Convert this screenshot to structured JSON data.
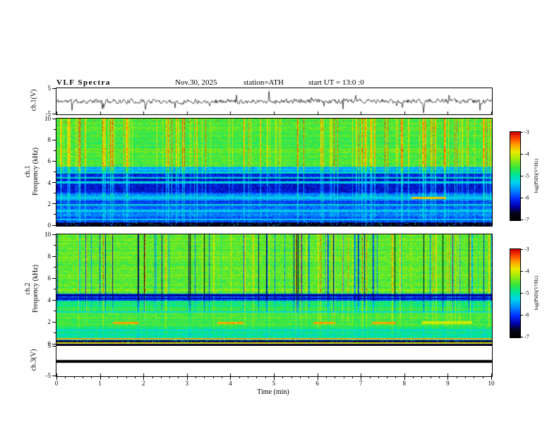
{
  "header": {
    "title": "VLF  Spectra",
    "date": "Nov.30, 2025",
    "station": "station=ATH",
    "start_ut": "start UT =  13:0 :0"
  },
  "axes": {
    "x": {
      "label": "Time  (min)",
      "ticks": [
        0,
        1,
        2,
        3,
        4,
        5,
        6,
        7,
        8,
        9,
        10
      ],
      "range": [
        0,
        10
      ]
    },
    "p1": {
      "label": "ch.1(V)",
      "ticks": [
        5,
        -5
      ],
      "range": [
        -5,
        5
      ]
    },
    "p2": {
      "label_ch": "ch.1",
      "label_freq": "Frequency  (kHz)",
      "ticks": [
        10,
        8,
        6,
        4,
        2,
        0
      ],
      "minor_ticks": [
        1,
        3,
        5,
        7,
        9
      ],
      "range": [
        0,
        10
      ]
    },
    "p3": {
      "label_ch": "ch.2",
      "label_freq": "Frequency  (kHz)",
      "ticks": [
        10,
        8,
        6,
        4,
        2,
        0
      ],
      "minor_ticks": [
        1,
        3,
        5,
        7,
        9
      ],
      "range": [
        0,
        10
      ]
    },
    "p4": {
      "label": "ch.3(V)",
      "ticks": [
        5,
        -5
      ],
      "range": [
        -5,
        5
      ]
    }
  },
  "colorbars": [
    {
      "label": "log(PSD)(V²/Hz)",
      "ticks": [
        -3,
        -4,
        -5,
        -6,
        -7
      ]
    },
    {
      "label": "log(PSD)(V²/Hz)",
      "ticks": [
        -3,
        -4,
        -5,
        -6,
        -7
      ]
    }
  ],
  "chart_data": [
    {
      "id": "ch1_waveform",
      "type": "line",
      "ylabel": "ch.1(V)",
      "ylim": [
        -5,
        5
      ],
      "yticks": [
        5,
        -5
      ],
      "xlim": [
        0,
        10
      ],
      "summary": "Broadband noisy voltage trace centered near 0 V (about ±1 V) with frequent impulsive sferic spikes reaching roughly ±4 V across the whole 10 minutes.",
      "render": {
        "seed": 11,
        "base_amplitude": 0.55,
        "spike_probability": 0.028,
        "spike_amplitude": 3.2
      }
    },
    {
      "id": "ch1_spectrogram",
      "type": "heatmap",
      "ylabel": "ch.1 Frequency (kHz)",
      "ylim": [
        0,
        10
      ],
      "yticks": [
        0,
        2,
        4,
        6,
        8,
        10
      ],
      "xlim": [
        0,
        10
      ],
      "value_label": "log(PSD)(V²/Hz)",
      "value_range": [
        -7,
        -3
      ],
      "seed": 22,
      "summary": "Green mottled background above ~5.5 kHz with dense bright yellow-green vertical sferic streaks; strong dark-blue low-power band ~3-5 kHz crossed by thin cyan horizontal lines; blue/cyan banded structure 0.3-3 kHz; near-black band below ~0.35 kHz; sparse red specks at the top edge and an orange segment near 2.6 kHz around t=8.2-9.0 min.",
      "bands": [
        {
          "f": [
            9.55,
            10.01
          ],
          "psd": -4.5,
          "mottle": 0.5,
          "specks": true
        },
        {
          "f": [
            5.5,
            9.55
          ],
          "psd": -4.55,
          "mottle": 0.55
        },
        {
          "f": [
            4.9,
            5.5
          ],
          "psd": -5.4,
          "mottle": 0.5
        },
        {
          "f": [
            3.0,
            4.9
          ],
          "psd": -6.15,
          "mottle": 0.6
        },
        {
          "f": [
            2.35,
            3.0
          ],
          "psd": -5.55,
          "mottle": 0.5
        },
        {
          "f": [
            1.55,
            2.35
          ],
          "psd": -5.9,
          "mottle": 0.5
        },
        {
          "f": [
            0.85,
            1.55
          ],
          "psd": -5.6,
          "mottle": 0.55
        },
        {
          "f": [
            0.35,
            0.85
          ],
          "psd": -5.85,
          "mottle": 0.6
        },
        {
          "f": [
            0.13,
            0.35
          ],
          "psd": -6.75,
          "mottle": 0.25
        },
        {
          "f": [
            0.0,
            0.13
          ],
          "psd": -6.9,
          "mottle": 0.1
        }
      ],
      "lines": [
        {
          "f": 4.95,
          "psd": -5.1
        },
        {
          "f": 4.5,
          "psd": -5.15
        },
        {
          "f": 4.05,
          "psd": -5.2
        },
        {
          "f": 2.6,
          "psd": -5.3
        },
        {
          "f": 1.95,
          "psd": -5.15
        },
        {
          "f": 1.4,
          "psd": -5.25
        },
        {
          "f": 0.6,
          "psd": -5.3
        }
      ],
      "streaks": {
        "bright_density": 0.16,
        "bright_boost": 0.95,
        "dark_density": 0.0,
        "dark_depth": 0,
        "full_above": 5.0,
        "min_scale": 0.35
      },
      "segments": [
        {
          "t": [
            8.15,
            8.95
          ],
          "f": 2.6,
          "halfwidth": 0.08,
          "psd": -3.7
        }
      ]
    },
    {
      "id": "ch2_spectrogram",
      "type": "heatmap",
      "ylabel": "ch.2 Frequency (kHz)",
      "ylim": [
        0,
        10
      ],
      "yticks": [
        0,
        2,
        4,
        6,
        8,
        10
      ],
      "xlim": [
        0,
        10
      ],
      "value_label": "log(PSD)(V²/Hz)",
      "value_range": [
        -7,
        -3
      ],
      "seed": 33,
      "summary": "Green/yellow mottled background with many dark-blue/black vertical dropout streaks above ~4.5 kHz; dark-blue horizontal band ~4-4.6 kHz; horizontally banded structure below 4 kHz including dashed red-brown segments near 2 kHz (around t=1.3-1.9, 3.7-4.3, 5.9-6.4, 7.25-7.8, 8.4-9.6 min), an orange line near 0.5 kHz, a black row near 0.3 kHz and a red-orange line along the bottom edge.",
      "bands": [
        {
          "f": [
            4.6,
            10.01
          ],
          "psd": -4.45,
          "mottle": 0.6
        },
        {
          "f": [
            4.0,
            4.6
          ],
          "psd": -5.9,
          "mottle": 0.5
        },
        {
          "f": [
            3.25,
            4.0
          ],
          "psd": -4.8,
          "mottle": 0.5
        },
        {
          "f": [
            2.3,
            3.25
          ],
          "psd": -4.5,
          "mottle": 0.55
        },
        {
          "f": [
            1.7,
            2.3
          ],
          "psd": -4.6,
          "mottle": 0.5
        },
        {
          "f": [
            1.0,
            1.7
          ],
          "psd": -4.8,
          "mottle": 0.55
        },
        {
          "f": [
            0.6,
            1.0
          ],
          "psd": -4.95,
          "mottle": 0.5
        },
        {
          "f": [
            0.38,
            0.6
          ],
          "psd": -5.1,
          "mottle": 0.4
        },
        {
          "f": [
            0.22,
            0.38
          ],
          "psd": -6.7,
          "mottle": 0.2
        },
        {
          "f": [
            0.08,
            0.22
          ],
          "psd": -3.9,
          "mottle": 0.3
        },
        {
          "f": [
            0.0,
            0.08
          ],
          "psd": -6.5,
          "mottle": 0.2
        }
      ],
      "lines": [
        {
          "f": 4.45,
          "psd": -6.4
        },
        {
          "f": 4.15,
          "psd": -6.3
        },
        {
          "f": 2.95,
          "psd": -5.2
        },
        {
          "f": 1.3,
          "psd": -5.2
        },
        {
          "f": 0.5,
          "psd": -3.6
        }
      ],
      "streaks": {
        "bright_density": 0.06,
        "bright_boost": 0.8,
        "dark_density": 0.08,
        "dark_depth": 1.8,
        "full_above": 4.6,
        "min_scale": 0.15
      },
      "segments": [
        {
          "t": [
            1.3,
            1.9
          ],
          "f": 1.95,
          "halfwidth": 0.12,
          "psd": -3.6
        },
        {
          "t": [
            3.7,
            4.3
          ],
          "f": 1.95,
          "halfwidth": 0.12,
          "psd": -3.6
        },
        {
          "t": [
            5.9,
            6.4
          ],
          "f": 1.95,
          "halfwidth": 0.12,
          "psd": -3.6
        },
        {
          "t": [
            7.25,
            7.8
          ],
          "f": 1.95,
          "halfwidth": 0.12,
          "psd": -3.6
        },
        {
          "t": [
            8.4,
            9.55
          ],
          "f": 2.0,
          "halfwidth": 0.14,
          "psd": -4.0
        }
      ]
    },
    {
      "id": "ch3_waveform",
      "type": "line",
      "ylabel": "ch.3(V)",
      "ylim": [
        -5,
        5
      ],
      "yticks": [
        5,
        -5
      ],
      "xlim": [
        0,
        10
      ],
      "summary": "Constant flat trace at 0 V for the entire interval (thick black horizontal line).",
      "render": {
        "constant_value": 0,
        "line_width": 4
      }
    }
  ]
}
